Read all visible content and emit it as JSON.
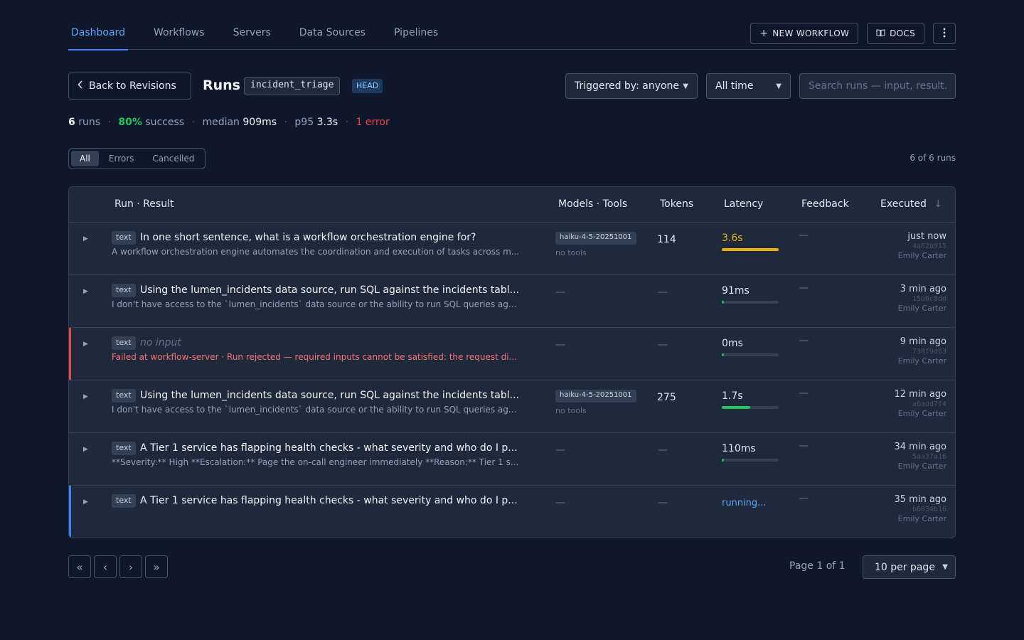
{
  "nav": {
    "tabs": [
      "Dashboard",
      "Workflows",
      "Servers",
      "Data Sources",
      "Pipelines"
    ],
    "active_tab": "Dashboard",
    "new_workflow_label": "NEW WORKFLOW",
    "docs_label": "DOCS"
  },
  "header": {
    "back_label": "Back to Revisions",
    "title": "Runs",
    "workflow_name": "incident_triage",
    "revision_badge": "HEAD",
    "triggered_filter": "Triggered by: anyone",
    "time_filter": "All time",
    "search_placeholder": "Search runs — input, result…"
  },
  "stats": {
    "runs_count": "6",
    "runs_label": "runs",
    "success_pct": "80%",
    "success_label": "success",
    "median_label": "median",
    "median_value": "909ms",
    "p95_label": "p95",
    "p95_value": "3.3s",
    "errors": "1 error"
  },
  "filter": {
    "options": [
      "All",
      "Errors",
      "Cancelled"
    ],
    "active": "All",
    "count_text": "6 of 6 runs"
  },
  "table": {
    "columns": {
      "run": "Run · Result",
      "models": "Models · Tools",
      "tokens": "Tokens",
      "latency": "Latency",
      "feedback": "Feedback",
      "executed": "Executed",
      "sort_icon": "↓"
    },
    "rows": [
      {
        "kind": "text",
        "input": "In one short sentence, what is a workflow orchestration engine for?",
        "result": "A workflow orchestration engine automates the coordination and execution of tasks across m...",
        "model": "haiku-4-5-20251001",
        "tools": "no tools",
        "tokens": "114",
        "latency": "3.6s",
        "latency_fraction": 1.0,
        "latency_color": "#eab308",
        "feedback": "—",
        "time": "just now",
        "hash": "4a62b915",
        "user": "Emily Carter"
      },
      {
        "kind": "text",
        "input": "Using the lumen_incidents data source, run SQL against the incidents tabl...",
        "result": "I don't have access to the `lumen_incidents` data source or the ability to run SQL queries ag...",
        "model": "—",
        "tools": "",
        "tokens": "—",
        "latency": "91ms",
        "latency_fraction": 0.03,
        "latency_color": "#22c55e",
        "feedback": "—",
        "time": "3 min ago",
        "hash": "15b0c8dd",
        "user": "Emily Carter"
      },
      {
        "kind": "text",
        "input": "no input",
        "result": "Failed at workflow-server · Run rejected — required inputs cannot be satisfied: the request di...",
        "model": "—",
        "tools": "",
        "tokens": "—",
        "latency": "0ms",
        "latency_fraction": 0.02,
        "latency_color": "#22c55e",
        "feedback": "—",
        "time": "9 min ago",
        "hash": "738f9d63",
        "user": "Emily Carter"
      },
      {
        "kind": "text",
        "input": "Using the lumen_incidents data source, run SQL against the incidents tabl...",
        "result": "I don't have access to the `lumen_incidents` data source or the ability to run SQL queries ag...",
        "model": "haiku-4-5-20251001",
        "tools": "no tools",
        "tokens": "275",
        "latency": "1.7s",
        "latency_fraction": 0.5,
        "latency_color": "#22c55e",
        "feedback": "—",
        "time": "12 min ago",
        "hash": "a6add7f4",
        "user": "Emily Carter"
      },
      {
        "kind": "text",
        "input": "A Tier 1 service has flapping health checks - what severity and who do I p...",
        "result": "**Severity:** High **Escalation:** Page the on-call engineer immediately **Reason:** Tier 1 s...",
        "model": "—",
        "tools": "",
        "tokens": "—",
        "latency": "110ms",
        "latency_fraction": 0.03,
        "latency_color": "#22c55e",
        "feedback": "—",
        "time": "34 min ago",
        "hash": "5aa37a16",
        "user": "Emily Carter"
      },
      {
        "kind": "text",
        "input": "A Tier 1 service has flapping health checks - what severity and who do I p...",
        "result": "",
        "model": "—",
        "tools": "",
        "tokens": "—",
        "latency": "running...",
        "feedback": "—",
        "time": "35 min ago",
        "hash": "b6034b16",
        "user": "Emily Carter"
      }
    ]
  },
  "pagination": {
    "page_info": "Page 1 of 1",
    "per_page": "10 per page"
  }
}
